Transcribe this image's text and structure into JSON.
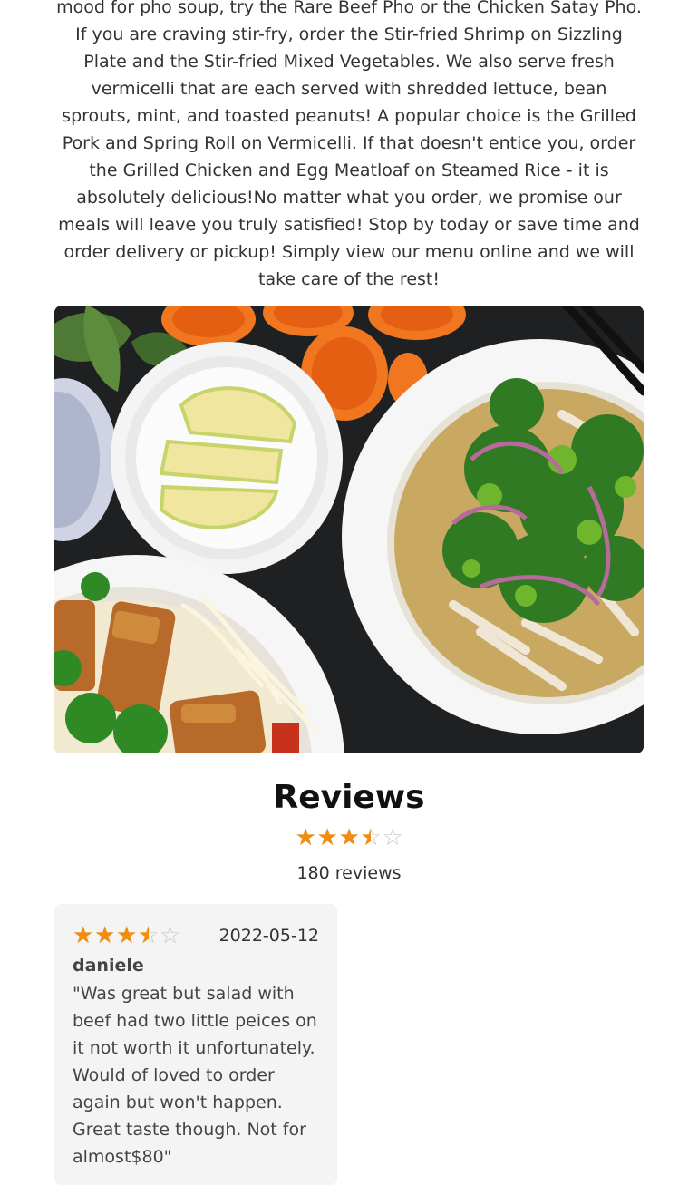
{
  "about": {
    "text": "mood for pho soup, try the Rare Beef Pho or the Chicken Satay Pho. If you are craving stir-fry, order the Stir-fried Shrimp on Sizzling Plate and the Stir-fried Mixed Vegetables. We also serve fresh vermicelli that are each served with shredded lettuce, bean sprouts, mint, and toasted peanuts! A popular choice is the Grilled Pork and Spring Roll on Vermicelli. If that doesn't entice you, order the Grilled Chicken and Egg Meatloaf on Steamed Rice - it is absolutely delicious!No matter what you order, we promise our meals will leave you truly satisfied! Stop by today or save time and order delivery or pickup! Simply view our menu online and we will take care of the rest!"
  },
  "reviews": {
    "title": "Reviews",
    "average_rating": 3.5,
    "max_rating": 5,
    "count_text": "180 reviews",
    "star_color": "#f28c0f",
    "items": [
      {
        "rating": 3.5,
        "date": "2022-05-12",
        "author": "daniele",
        "text": "\"Was great but salad with beef had two little peices on it not worth it unfortunately. Would of loved to order again but won't happen. Great taste though. Not for almost$80\""
      }
    ]
  }
}
